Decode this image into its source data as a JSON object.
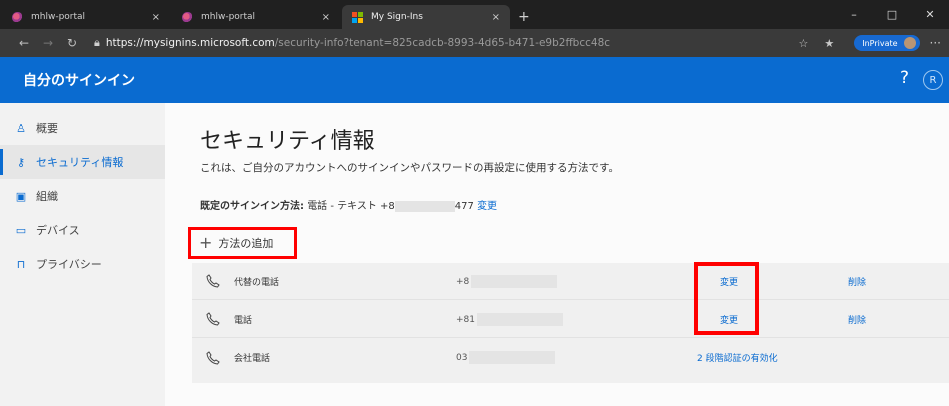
{
  "browser": {
    "tabs": [
      {
        "title": "mhlw-portal",
        "favicon": "mhlw-icon",
        "close": "×"
      },
      {
        "title": "mhlw-portal",
        "favicon": "mhlw-icon",
        "close": "×"
      },
      {
        "title": "My Sign-Ins",
        "favicon": "microsoft-icon",
        "close": "×"
      }
    ],
    "new_tab": "+",
    "window_controls": {
      "minimize": "–",
      "maximize": "□",
      "close": "✕"
    },
    "url_scheme": "https://",
    "url_host": "mysignins.microsoft.com",
    "url_rest": "/security-info?tenant=825cadcb-8993-4d65-b471-e9b2ffbcc48c",
    "inprivate_label": "InPrivate",
    "more": "···",
    "ms_colors": [
      "#f25022",
      "#7fba00",
      "#00a4ef",
      "#ffb900"
    ]
  },
  "header": {
    "title": "自分のサインイン",
    "help": "?",
    "avatar": "R",
    "accent": "#0a6bd0"
  },
  "sidebar": {
    "items": [
      {
        "label": "概要",
        "icon": "person-icon",
        "glyph": "♙"
      },
      {
        "label": "セキュリティ情報",
        "icon": "key-person-icon",
        "glyph": "⚷"
      },
      {
        "label": "組織",
        "icon": "briefcase-icon",
        "glyph": "▣"
      },
      {
        "label": "デバイス",
        "icon": "laptop-icon",
        "glyph": "▭"
      },
      {
        "label": "プライバシー",
        "icon": "lock-icon",
        "glyph": "🔒"
      }
    ],
    "active_index": 1
  },
  "main": {
    "title": "セキュリティ情報",
    "description": "これは、ご自分のアカウントへのサインインやパスワードの再設定に使用する方法です。",
    "default_label": "既定のサインイン方法:",
    "default_value_prefix": "電話 - テキスト +8",
    "default_value_suffix": "477",
    "default_change": "変更",
    "add_method": "方法の追加",
    "methods": [
      {
        "name": "代替の電話",
        "value_prefix": "+8",
        "action": "変更",
        "delete": "削除"
      },
      {
        "name": "電話",
        "value_prefix": "+81",
        "action": "変更",
        "delete": "削除"
      },
      {
        "name": "会社電話",
        "value_prefix": "03",
        "action": "2 段階認証の有効化",
        "delete": ""
      }
    ]
  }
}
